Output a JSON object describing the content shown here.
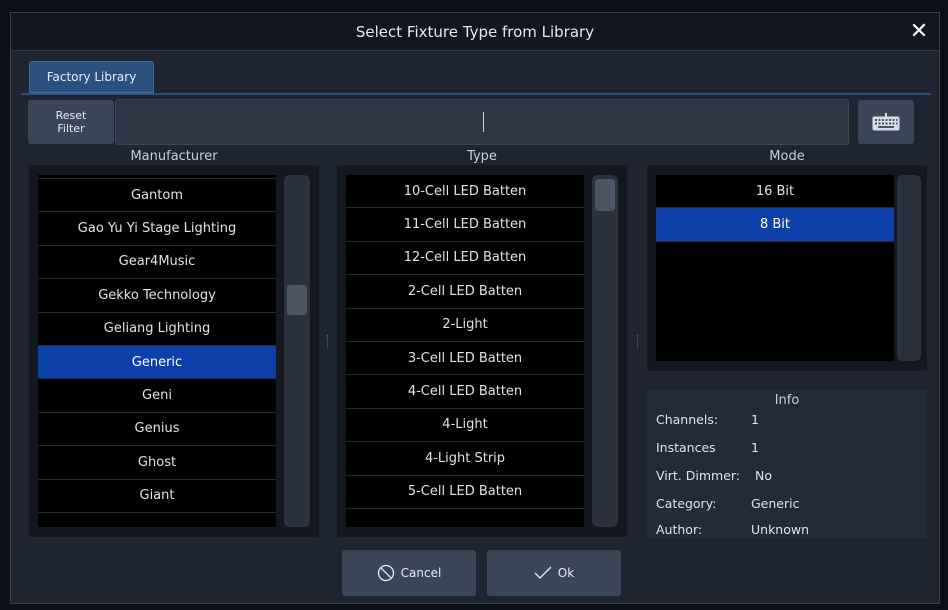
{
  "dialog": {
    "title": "Select Fixture Type from Library",
    "close_label": "✕"
  },
  "tabs": [
    {
      "label": "Factory Library",
      "active": true
    }
  ],
  "toolbar": {
    "reset_label": "Reset\nFilter",
    "search_value": ""
  },
  "columns": {
    "manufacturer": {
      "header": "Manufacturer",
      "items": [
        "Gantom",
        "Gao Yu Yi Stage Lighting",
        "Gear4Music",
        "Gekko Technology",
        "Geliang Lighting",
        "Generic",
        "Geni",
        "Genius",
        "Ghost",
        "Giant"
      ],
      "selected": "Generic"
    },
    "type": {
      "header": "Type",
      "items": [
        "10-Cell LED Batten",
        "11-Cell LED Batten",
        "12-Cell LED Batten",
        "2-Cell LED Batten",
        "2-Light",
        "3-Cell LED Batten",
        "4-Cell LED Batten",
        "4-Light",
        "4-Light Strip",
        "5-Cell LED Batten"
      ]
    },
    "mode": {
      "header": "Mode",
      "items": [
        "16 Bit",
        "8 Bit"
      ],
      "selected": "8 Bit"
    }
  },
  "info": {
    "title": "Info",
    "rows": [
      {
        "key": "Channels:",
        "value": "1"
      },
      {
        "key": "Instances",
        "value": "1"
      },
      {
        "key": "Virt. Dimmer:",
        "value": "No"
      },
      {
        "key": "Category:",
        "value": "Generic"
      },
      {
        "key": "Author:",
        "value": "Unknown"
      }
    ]
  },
  "footer": {
    "cancel_label": "Cancel",
    "ok_label": "Ok"
  },
  "colors": {
    "selection": "#0d3fa8",
    "accent_tab": "#2b4f7e",
    "background": "#1f2530"
  }
}
